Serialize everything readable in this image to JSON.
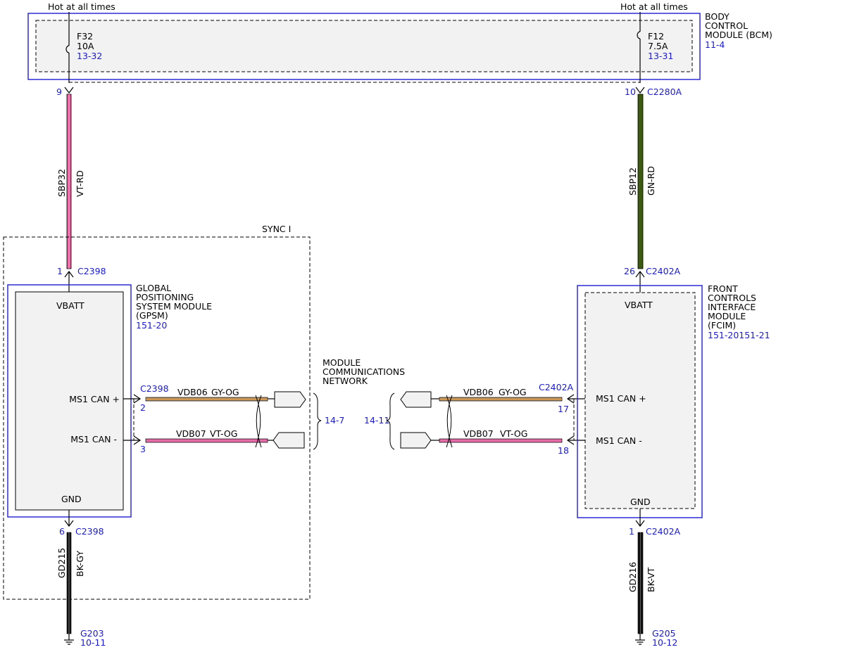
{
  "power": {
    "left_label": "Hot at all times",
    "right_label": "Hot at all times"
  },
  "bcm": {
    "name_line1": "BODY",
    "name_line2": "CONTROL",
    "name_line3": "MODULE (BCM)",
    "ref": "11-4",
    "fuse_left": {
      "id": "F32",
      "rating": "10A",
      "ref": "13-32"
    },
    "fuse_right": {
      "id": "F12",
      "rating": "7.5A",
      "ref": "13-31"
    }
  },
  "circuits": {
    "left_power": {
      "pin_top": "9",
      "circuit": "SBP32",
      "color": "VT-RD",
      "pin_bottom": "1",
      "connector_bottom": "C2398"
    },
    "right_power": {
      "pin_top": "10",
      "connector_top": "C2280A",
      "circuit": "SBP12",
      "color": "GN-RD",
      "pin_bottom": "26",
      "connector_bottom": "C2402A"
    },
    "left_ground": {
      "pin": "6",
      "connector": "C2398",
      "circuit": "GD215",
      "color": "BK-GY",
      "ground": "G203",
      "ground_ref": "10-11"
    },
    "right_ground": {
      "pin": "1",
      "connector": "C2402A",
      "circuit": "GD216",
      "color": "BK-VT",
      "ground": "G205",
      "ground_ref": "10-12"
    }
  },
  "sync": {
    "label": "SYNC I"
  },
  "gpsm": {
    "name_line1": "GLOBAL",
    "name_line2": "POSITIONING",
    "name_line3": "SYSTEM MODULE",
    "name_line4": "(GPSM)",
    "ref": "151-20",
    "vbatt": "VBATT",
    "can_plus": "MS1 CAN +",
    "can_minus": "MS1 CAN -",
    "gnd": "GND",
    "can_connector": "C2398",
    "pin_plus": "2",
    "pin_minus": "3",
    "wire_plus_circuit": "VDB06",
    "wire_plus_color": "GY-OG",
    "wire_minus_circuit": "VDB07",
    "wire_minus_color": "VT-OG",
    "network_ref": "14-7"
  },
  "network": {
    "line1": "MODULE",
    "line2": "COMMUNICATIONS",
    "line3": "NETWORK"
  },
  "fcim": {
    "name_line1": "FRONT",
    "name_line2": "CONTROLS",
    "name_line3": "INTERFACE",
    "name_line4": "MODULE",
    "name_line5": "(FCIM)",
    "ref": "151-20151-21",
    "vbatt": "VBATT",
    "can_plus": "MS1 CAN +",
    "can_minus": "MS1 CAN -",
    "gnd": "GND",
    "can_connector": "C2402A",
    "pin_plus": "17",
    "pin_minus": "18",
    "wire_plus_circuit": "VDB06",
    "wire_plus_color": "GY-OG",
    "wire_minus_circuit": "VDB07",
    "wire_minus_color": "VT-OG",
    "network_ref": "14-11"
  },
  "colors": {
    "module_border": "#2b2bd6",
    "ref_text": "#1a1acc",
    "wire_vt_rd": "#e8559a",
    "wire_gn_rd": "#3d5a12",
    "wire_gy_og": "#b8956a",
    "wire_vt_og": "#e46aa8",
    "wire_black": "#111111"
  }
}
